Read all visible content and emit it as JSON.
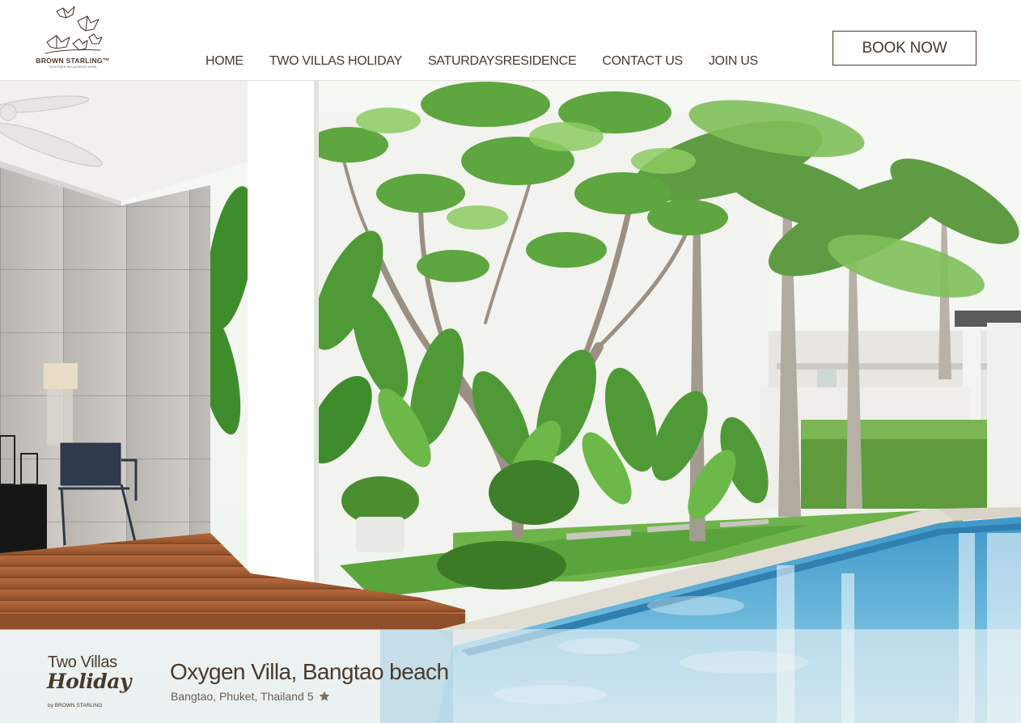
{
  "brand": {
    "name": "BROWN STARLING",
    "trademark": "™",
    "tagline": "TOGETHER WE ACHIEVE MORE",
    "logo_icon": "birds-logo-icon",
    "text_color": "#4a3a2c"
  },
  "nav": {
    "items": [
      {
        "label": "HOME"
      },
      {
        "label": "TWO VILLAS HOLIDAY"
      },
      {
        "label": "SATURDAYSRESIDENCE"
      },
      {
        "label": "CONTACT US"
      },
      {
        "label": "JOIN US"
      }
    ]
  },
  "cta": {
    "book_label": "BOOK NOW"
  },
  "hero": {
    "image": "pool-villa-garden-photo"
  },
  "listing": {
    "badge": {
      "line1": "Two Villas",
      "line2": "Holiday",
      "line3": "by BROWN STARLING"
    },
    "title": "Oxygen Villa, Bangtao beach",
    "location": "Bangtao, Phuket, Thailand",
    "rating": "5",
    "rating_icon": "star-icon",
    "star_color": "#7c6e62"
  }
}
